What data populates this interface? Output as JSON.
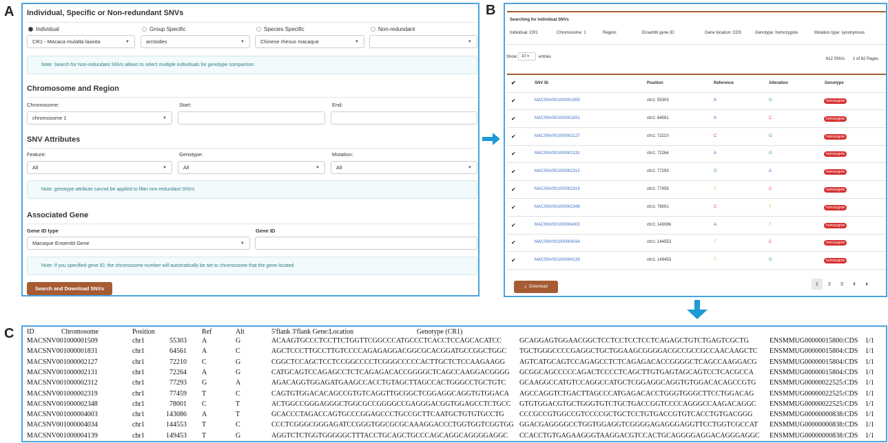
{
  "labels": {
    "a": "A",
    "b": "B",
    "c": "C"
  },
  "panelA": {
    "title": "Individual, Specific or Non-redundant SNVs",
    "radios": [
      {
        "label": "Individual",
        "checked": true
      },
      {
        "label": "Group Specific",
        "checked": false
      },
      {
        "label": "Species Specific",
        "checked": false
      },
      {
        "label": "Non-redundant",
        "checked": false
      }
    ],
    "selects": [
      "CR1 - Macaca mulatta lasiota",
      "arctoides",
      "Chinese rhesus macaque",
      ""
    ],
    "note1": "Note: Search for Non-redundant SNVs allows to select multiple individuals for genotype comparison",
    "chrom_title": "Chromosome and Region",
    "chrom_label": "Chromosome:",
    "chrom_value": "chromosome 1",
    "start_label": "Start:",
    "end_label": "End:",
    "attr_title": "SNV Attributes",
    "feature_label": "Feature:",
    "feature_value": "All",
    "genotype_label": "Genotype:",
    "genotype_value": "All",
    "mutation_label": "Mutation:",
    "mutation_value": "All",
    "note2": "Note: genotype attribute cannot be applied to filter non-redundant SNVs",
    "gene_title": "Associated Gene",
    "geneid_type_label": "Gene ID type",
    "geneid_type_value": "Macaque Ensembl Gene",
    "geneid_label": "Gene ID",
    "note3": "Note: If you specified gene ID, the chromosome number will automatically be set to chromosome that the gene located",
    "search_button": "Search and Download SNVs"
  },
  "panelB": {
    "title": "Searching for individual SNVs",
    "filters": {
      "individual": "Individual: CR1",
      "chromosome": "Chromosome: 1",
      "region": "Region:",
      "ensembl": "Ensembl gene ID:",
      "location": "Gene location: CDS",
      "genotype": "Genotype: homozygote",
      "mutation": "Mutation type: synonymous"
    },
    "show": "Show",
    "entries_value": "10",
    "entries": "entries",
    "count": "612 SNVs",
    "pages": "1 of 62 Pages",
    "headers": [
      "SNV ID",
      "Position",
      "Reference",
      "Alteration",
      "Genotype"
    ],
    "rows": [
      {
        "id": "MACSNV001000001509",
        "pos": "chr1: 55303",
        "ref": "A",
        "alt": "G",
        "gt": "homozygote"
      },
      {
        "id": "MACSNV001000001831",
        "pos": "chr1: 64561",
        "ref": "A",
        "alt": "C",
        "gt": "homozygote"
      },
      {
        "id": "MACSNV001000002127",
        "pos": "chr1: 72210",
        "ref": "C",
        "alt": "G",
        "gt": "homozygote"
      },
      {
        "id": "MACSNV001000002131",
        "pos": "chr1: 72264",
        "ref": "A",
        "alt": "G",
        "gt": "homozygote"
      },
      {
        "id": "MACSNV001000002312",
        "pos": "chr1: 77293",
        "ref": "G",
        "alt": "A",
        "gt": "homozygote"
      },
      {
        "id": "MACSNV001000002319",
        "pos": "chr1: 77459",
        "ref": "T",
        "alt": "C",
        "gt": "homozygote"
      },
      {
        "id": "MACSNV001000002348",
        "pos": "chr1: 78001",
        "ref": "C",
        "alt": "T",
        "gt": "homozygote"
      },
      {
        "id": "MACSNV001000004003",
        "pos": "chr1: 143086",
        "ref": "A",
        "alt": "T",
        "gt": "homozygote"
      },
      {
        "id": "MACSNV001000004034",
        "pos": "chr1: 144553",
        "ref": "T",
        "alt": "C",
        "gt": "homozygote"
      },
      {
        "id": "MACSNV001000004139",
        "pos": "chr1: 149453",
        "ref": "T",
        "alt": "G",
        "gt": "homozygote"
      }
    ],
    "download": "Download",
    "pagination": [
      "1",
      "2",
      "3",
      "4",
      "›"
    ],
    "base_colors": {
      "A": "#3a5fc8",
      "C": "#d63a2f",
      "G": "#2fa33a",
      "T": "#f0a030"
    }
  },
  "panelC": {
    "header": [
      "ID",
      "Chromosome",
      "Position",
      "Ref",
      "Alt",
      "5'flank 3'flank Gene:Location",
      "Genotype (CR1)"
    ],
    "rows": [
      [
        "MACSNV001000001509",
        "chr1",
        "55303",
        "A",
        "G",
        "ACAAGTGCCCTCCTTCTGGTTCGGCCCATGCCCTCACCTCCAGCACATCC",
        "GCAGGAGTGGAACGGCTCCTCCTCCTCCTCAGAGCTGTCTGAGTCGCTG",
        "ENSMMUG00000015800:CDS",
        "1/1"
      ],
      [
        "MACSNV001000001831",
        "chr1",
        "64561",
        "A",
        "C",
        "AGCTCCCTTGCCTTGTCCCCAGAGAGGACGGCGCACGGATGCCGGCTGGC",
        "TGCTGGGCCCCGAGGCTGCTGGAAGCGGGGACGCCGCCGCCAACAAGCTC",
        "ENSMMUG00000015804:CDS",
        "1/1"
      ],
      [
        "MACSNV001000002127",
        "chr1",
        "72210",
        "C",
        "G",
        "CGGCTCCAGCTCCTCCGGCCCCTCGGGCCCCCACTTGCTCTCCAAGAAGG",
        "AGTCATGCAGTCCAGAGCCTCTCAGAGACACCGGGGCTCAGCCAAGGACG",
        "ENSMMUG00000015804:CDS",
        "1/1"
      ],
      [
        "MACSNV001000002131",
        "chr1",
        "72264",
        "A",
        "G",
        "CATGCAGTCCAGAGCCTCTCAGAGACACCGGGGCTCAGCCAAGGACGGGG",
        "GCGGCAGCCCCCAGACTCCCCTCAGCTTGTGAGTAGCAGTCCTCACGCCA",
        "ENSMMUG00000015804:CDS",
        "1/1"
      ],
      [
        "MACSNV001000002312",
        "chr1",
        "77293",
        "G",
        "A",
        "AGACAGGTGGAGATGAAGCCACCTGTAGCTTAGCCACTGGGCCTGCTGTC",
        "GCAAGGCCATGTCCAGGCCATGCTCGGAGGCAGGTGTGGACACAGCCGTG",
        "ENSMMUG00000022525:CDS",
        "1/1"
      ],
      [
        "MACSNV001000002319",
        "chr1",
        "77459",
        "T",
        "C",
        "CAGTGTGGACACAGCCGTGTCAGGTTGCGGCTCGGAGGCAGGTGTGGACA",
        "AGCCAGGTCTGACTTAGCCCATGAGACACCTGGGTGGGCTTCCTGGACAG",
        "ENSMMUG00000022525:CDS",
        "1/1"
      ],
      [
        "MACSNV001000002348",
        "chr1",
        "78001",
        "C",
        "T",
        "ACTGGCCGGGAGGGCTGGCGCCGGGGCCGAGGGACGGTGGAGCCTCTGCC",
        "GTGTGGACGTGCTGGGTGTCTGCTGACCGGTCCCCAGGGCCAAGACAGGC",
        "ENSMMUG00000022525:CDS",
        "1/1"
      ],
      [
        "MACSNV001000004003",
        "chr1",
        "143086",
        "A",
        "T",
        "GCACCCTAGACCAGTGCCCGGAGCCCTGCCGCTTCAATGCTGTGTGCCTG",
        "CCCGCCGTGGCCGTCCCCGCTGCTCCTGTGACCGTGTCACCTGTGACGGG",
        "ENSMMUG00000000838:CDS",
        "1/1"
      ],
      [
        "MACSNV001000004034",
        "chr1",
        "144553",
        "T",
        "C",
        "CCCTCGGGCGGGAGATCCGGGTGGCGCGCAAAGGACCCTGGTGGTCGGTGG",
        "GGACGAGGGGCCTGGTGGAGGTCGGGGAGAGGGAGGTTCCTGGTCGCCAT",
        "ENSMMUG00000000838:CDS",
        "1/1"
      ],
      [
        "MACSNV001000004139",
        "chr1",
        "149453",
        "T",
        "G",
        "AGGTCTCTGGTGGGGGCTTTACCTGCAGCTGCCCAGCAGGCAGGGGAGGC",
        "CCACCTGTGAGAAGGGTAAGGACGTCCACTGCAGGGGAGGACAGGGAGGC",
        "ENSMMUG00000000838:CDS",
        "1/1"
      ]
    ]
  }
}
